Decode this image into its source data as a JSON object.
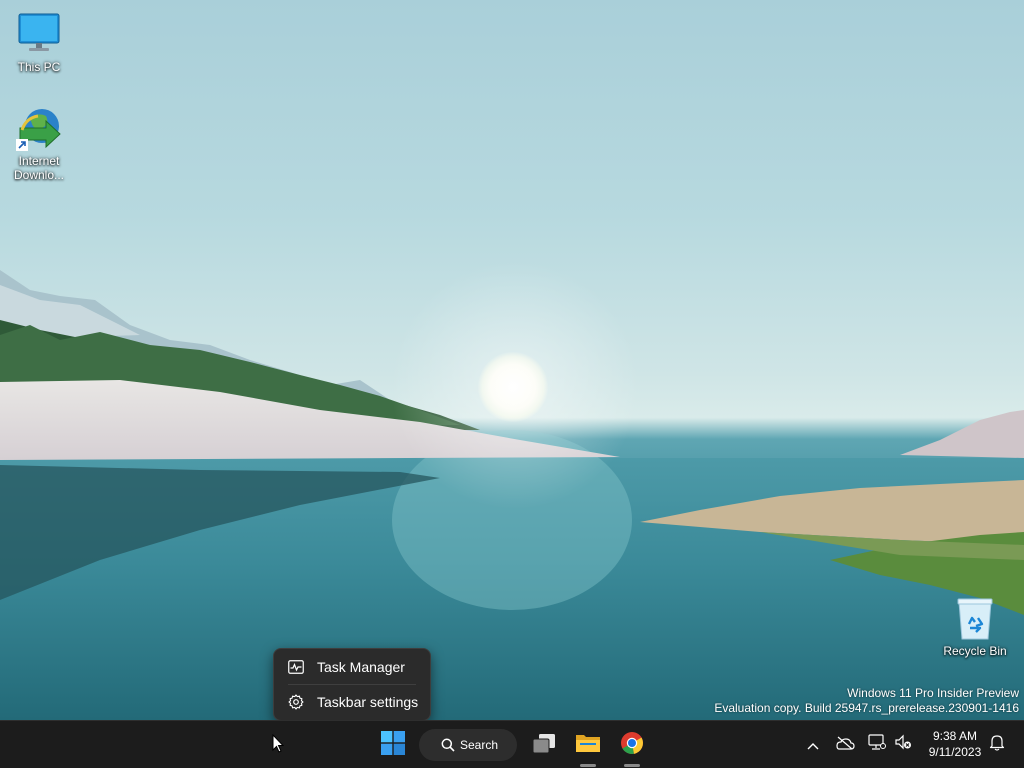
{
  "desktop": {
    "icons": [
      {
        "label": "This PC"
      },
      {
        "label": "Internet Downlo..."
      },
      {
        "label": "Recycle Bin"
      }
    ],
    "watermark": {
      "line1": "Windows 11 Pro Insider Preview",
      "line2": "Evaluation copy. Build 25947.rs_prerelease.230901-1416"
    }
  },
  "context_menu": {
    "items": [
      {
        "label": "Task Manager",
        "icon": "task-manager-icon"
      },
      {
        "label": "Taskbar settings",
        "icon": "gear-icon"
      }
    ]
  },
  "taskbar": {
    "search_label": "Search",
    "apps": [
      "start-icon",
      "task-view-icon",
      "file-explorer-icon",
      "chrome-icon"
    ],
    "tray": {
      "icons": [
        "chevron-up-icon",
        "onedrive-icon",
        "network-icon",
        "volume-muted-icon"
      ],
      "time": "9:38 AM",
      "date": "9/11/2023"
    }
  },
  "colors": {
    "taskbar_bg": "#1c1c1c",
    "menu_bg": "#2b2b2b",
    "start_blue": "#3aa0f0"
  }
}
